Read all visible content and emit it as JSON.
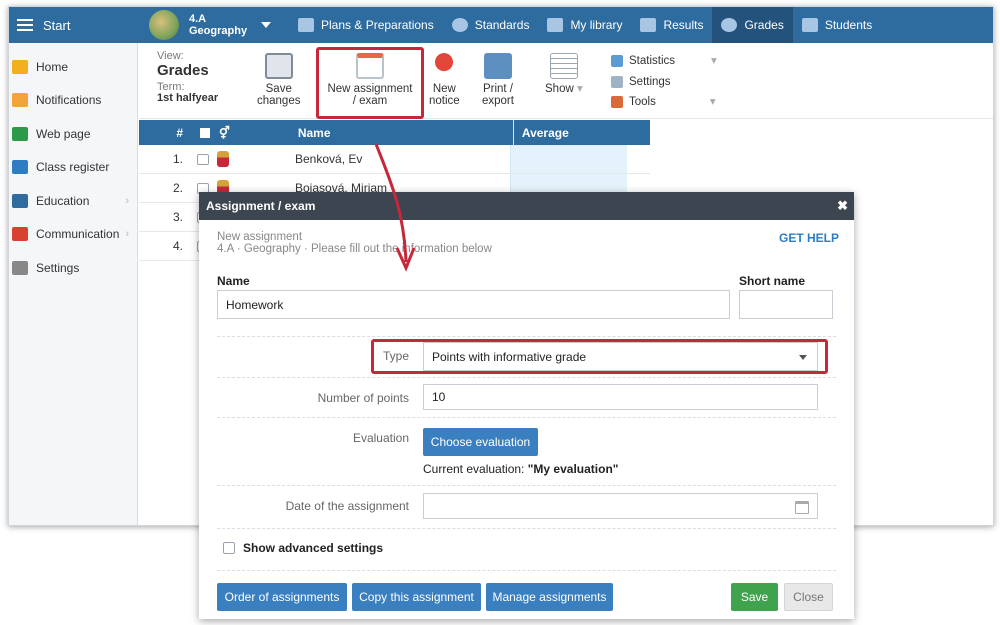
{
  "topbar": {
    "start_label": "Start",
    "class_name": "4.A",
    "subject": "Geography",
    "nav": [
      {
        "label": "Plans & Preparations",
        "icon": "folder-icon"
      },
      {
        "label": "Standards",
        "icon": "shield-icon"
      },
      {
        "label": "My library",
        "icon": "library-icon"
      },
      {
        "label": "Results",
        "icon": "bar-chart-icon"
      },
      {
        "label": "Grades",
        "icon": "grades-icon"
      },
      {
        "label": "Students",
        "icon": "students-icon"
      }
    ]
  },
  "sidebar": {
    "items": [
      {
        "label": "Home",
        "icon": "star-icon",
        "color": "#f2b01e"
      },
      {
        "label": "Notifications",
        "icon": "envelope-icon",
        "color": "#f2a33a"
      },
      {
        "label": "Web page",
        "icon": "house-icon",
        "color": "#2d9a4a"
      },
      {
        "label": "Class register",
        "icon": "register-icon",
        "color": "#2e7cc3"
      },
      {
        "label": "Education",
        "icon": "book-icon",
        "color": "#2e6b9e"
      },
      {
        "label": "Communication",
        "icon": "chat-icon",
        "color": "#d9412f"
      },
      {
        "label": "Settings",
        "icon": "gear-icon",
        "color": "#888888"
      }
    ]
  },
  "toolbar": {
    "view_label": "View:",
    "view_value": "Grades",
    "term_label": "Term:",
    "term_value": "1st halfyear",
    "save_l1": "Save",
    "save_l2": "changes",
    "new_l1": "New assignment",
    "new_l2": "/ exam",
    "notice_l1": "New",
    "notice_l2": "notice",
    "print_l1": "Print /",
    "print_l2": "export",
    "show_label": "Show",
    "statistics_label": "Statistics",
    "settings_label": "Settings",
    "tools_label": "Tools"
  },
  "grid": {
    "headers": {
      "num": "#",
      "name": "Name",
      "average": "Average"
    },
    "rows": [
      {
        "num": "1.",
        "name": "Benková, Ev"
      },
      {
        "num": "2.",
        "name": "Bojasová, Miriam"
      },
      {
        "num": "3.",
        "name": ""
      },
      {
        "num": "4.",
        "name": ""
      }
    ]
  },
  "modal": {
    "title": "Assignment / exam",
    "subtitle_1": "New assignment",
    "subtitle_2": "4.A · Geography · Please fill out the information below",
    "get_help": "GET HELP",
    "name_label": "Name",
    "name_value": "Homework",
    "short_name_label": "Short name",
    "short_name_value": "",
    "type_label": "Type",
    "type_value": "Points with informative grade",
    "points_label": "Number of points",
    "points_value": "10",
    "evaluation_label": "Evaluation",
    "choose_eval": "Choose evaluation",
    "current_eval_label": "Current evaluation:",
    "current_eval_value": "\"My evaluation\"",
    "date_label": "Date of the assignment",
    "date_value": "",
    "advanced_label": "Show advanced settings",
    "order_btn": "Order of assignments",
    "copy_btn": "Copy this assignment",
    "manage_btn": "Manage assignments",
    "save_btn": "Save",
    "close_btn": "Close"
  },
  "colors": {
    "accent": "#2e6b9e",
    "highlight": "#c6283a",
    "save": "#3fa34d"
  }
}
